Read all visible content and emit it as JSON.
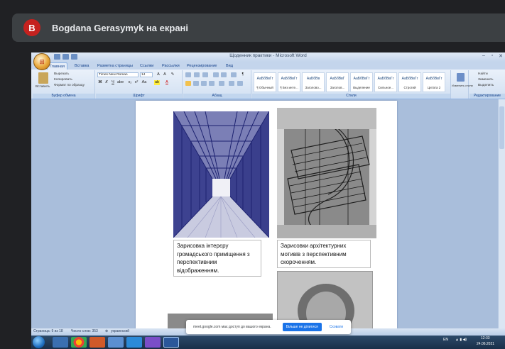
{
  "meet": {
    "avatar_letter": "B",
    "banner_text": "Bogdana Gerasymyk на екрані",
    "notification": {
      "text": "meet.google.com має доступ до вашого екрана.",
      "primary": "Більше не ділитися",
      "secondary": "Сховати"
    }
  },
  "word": {
    "title": "Щоденник практики - Microsoft Word",
    "tabs": [
      "Главная",
      "Вставка",
      "Разметка страницы",
      "Ссылки",
      "Рассылки",
      "Рецензирование",
      "Вид"
    ],
    "clipboard": {
      "label": "Буфер обмена",
      "paste": "Вставить",
      "cut": "Вырезать",
      "copy": "Копировать",
      "format_painter": "Формат по образцу"
    },
    "font": {
      "label": "Шрифт",
      "name": "Times New Roman",
      "size": "14"
    },
    "paragraph": {
      "label": "Абзац"
    },
    "styles": {
      "label": "Стили",
      "items": [
        {
          "sample": "АаБбВвГг",
          "name": "¶ Обычный"
        },
        {
          "sample": "АаБбВвГг",
          "name": "¶ Без инте..."
        },
        {
          "sample": "АаБбВв",
          "name": "Заголово..."
        },
        {
          "sample": "АаБбВвГ",
          "name": "Заголов..."
        },
        {
          "sample": "АаБбВвГг",
          "name": "Выделение"
        },
        {
          "sample": "АаБбВвГг",
          "name": "Сильное..."
        },
        {
          "sample": "АаБбВвГг",
          "name": "Строгий"
        },
        {
          "sample": "АаБбВвГг",
          "name": "Цитата 2"
        }
      ],
      "change_styles": "Изменить стили"
    },
    "editing": {
      "label": "Редактирование",
      "find": "Найти",
      "replace": "Заменить",
      "select": "Выделить"
    },
    "document": {
      "caption_left": "Зарисовка інтерєру громадського приміщення з перспективним відображенням.",
      "caption_right": "Зарисовки архітектурних мотивів з перспективним скороченням."
    },
    "status": {
      "page": "Страница: 9 из 18",
      "words": "Число слов: 353",
      "language": "украинский"
    }
  },
  "taskbar": {
    "language": "EN",
    "time": "12:33",
    "date": "24.06.2021"
  }
}
